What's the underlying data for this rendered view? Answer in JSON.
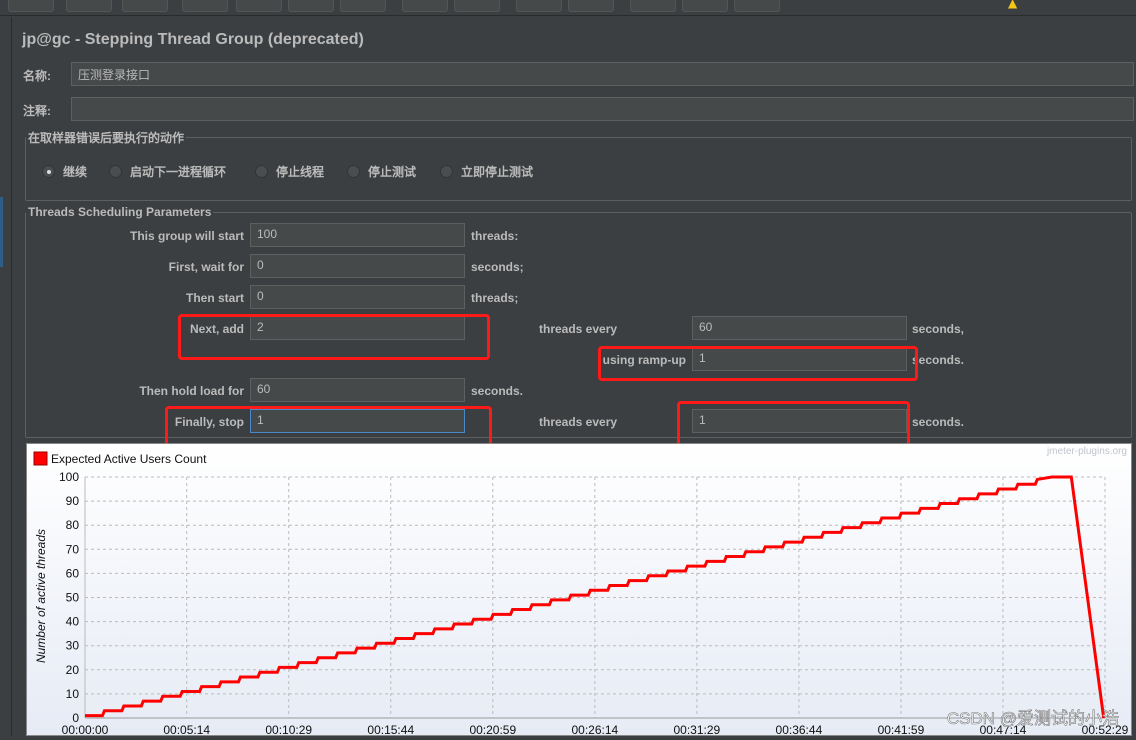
{
  "window": {
    "title": "jp@gc - Stepping Thread Group (deprecated)"
  },
  "form": {
    "name_label": "名称:",
    "name_value": "压测登录接口",
    "comment_label": "注释:",
    "comment_value": "",
    "error_action": {
      "legend": "在取样器错误后要执行的动作",
      "options": [
        {
          "label": "继续",
          "selected": true
        },
        {
          "label": "启动下一进程循环",
          "selected": false
        },
        {
          "label": "停止线程",
          "selected": false
        },
        {
          "label": "停止测试",
          "selected": false
        },
        {
          "label": "立即停止测试",
          "selected": false
        }
      ]
    },
    "scheduling": {
      "legend": "Threads Scheduling Parameters",
      "start_label": "This group will start",
      "start_value": "100",
      "start_unit": "threads:",
      "wait_label": "First, wait for",
      "wait_value": "0",
      "wait_unit": "seconds;",
      "then_label": "Then start",
      "then_value": "0",
      "then_unit": "threads;",
      "next_label": "Next, add",
      "next_value": "2",
      "next_mid": "threads every",
      "next_every": "60",
      "next_unit": "seconds,",
      "ramp_label": "using ramp-up",
      "ramp_value": "1",
      "ramp_unit": "seconds.",
      "hold_label": "Then hold load for",
      "hold_value": "60",
      "hold_unit": "seconds.",
      "stop_label": "Finally, stop",
      "stop_value": "1",
      "stop_mid": "threads every",
      "stop_every": "1",
      "stop_unit": "seconds."
    }
  },
  "highlight_color": "#ff1a1a",
  "watermark": "CSDN @爱测试的小浩",
  "chart_data": {
    "type": "line",
    "credit": "jmeter-plugins.org",
    "legend": "top-left",
    "ylabel": "Number of active threads",
    "xlabel": "",
    "grid": true,
    "ylim": [
      0,
      100
    ],
    "xlim": [
      "00:00:00",
      "00:52:29"
    ],
    "yticks": [
      "0",
      "10",
      "20",
      "30",
      "40",
      "50",
      "60",
      "70",
      "80",
      "90",
      "100"
    ],
    "xticks": [
      "00:00:00",
      "00:05:14",
      "00:10:29",
      "00:15:44",
      "00:20:59",
      "00:26:14",
      "00:31:29",
      "00:36:44",
      "00:41:59",
      "00:47:14",
      "00:52:29"
    ],
    "series": [
      {
        "name": "Expected Active Users Count",
        "color": "#ff0000",
        "x": [
          "00:00:00",
          "00:01:00",
          "00:02:00",
          "00:03:00",
          "00:04:00",
          "00:05:00",
          "00:06:00",
          "00:07:00",
          "00:08:00",
          "00:09:00",
          "00:10:00",
          "00:11:00",
          "00:12:00",
          "00:13:00",
          "00:14:00",
          "00:15:00",
          "00:16:00",
          "00:17:00",
          "00:18:00",
          "00:19:00",
          "00:20:00",
          "00:21:00",
          "00:22:00",
          "00:23:00",
          "00:24:00",
          "00:25:00",
          "00:26:00",
          "00:27:00",
          "00:28:00",
          "00:29:00",
          "00:30:00",
          "00:31:00",
          "00:32:00",
          "00:33:00",
          "00:34:00",
          "00:35:00",
          "00:36:00",
          "00:37:00",
          "00:38:00",
          "00:39:00",
          "00:40:00",
          "00:41:00",
          "00:42:00",
          "00:43:00",
          "00:44:00",
          "00:45:00",
          "00:46:00",
          "00:47:00",
          "00:48:00",
          "00:49:00",
          "00:49:45",
          "00:50:45",
          "00:52:25"
        ],
        "y": [
          1,
          3,
          5,
          7,
          9,
          11,
          13,
          15,
          17,
          19,
          21,
          23,
          25,
          27,
          29,
          31,
          33,
          35,
          37,
          39,
          41,
          43,
          45,
          47,
          49,
          51,
          53,
          55,
          57,
          59,
          61,
          63,
          65,
          67,
          69,
          71,
          73,
          75,
          77,
          79,
          81,
          83,
          85,
          87,
          89,
          91,
          93,
          95,
          97,
          99,
          100,
          100,
          0
        ]
      }
    ]
  }
}
